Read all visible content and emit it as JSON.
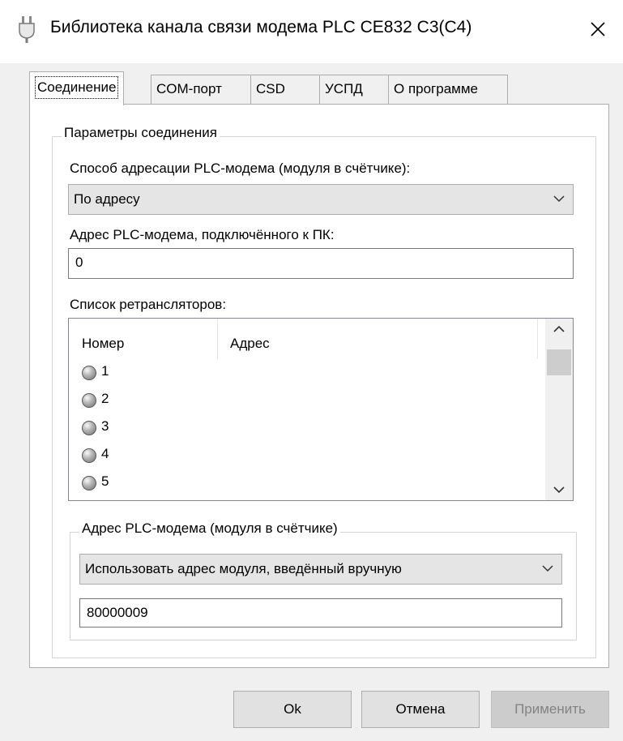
{
  "window": {
    "title": "Библиотека канала связи модема PLC CE832 C3(C4)",
    "icon": "plug-icon",
    "close_icon": "close-icon"
  },
  "tabs": [
    {
      "label": "Соединение",
      "active": true
    },
    {
      "label": "COM-порт",
      "active": false
    },
    {
      "label": "CSD",
      "active": false
    },
    {
      "label": "УСПД",
      "active": false
    },
    {
      "label": "О программе",
      "active": false
    }
  ],
  "connection_params": {
    "group_label": "Параметры соединения",
    "addressing_method_label": "Способ адресации PLC-модема (модуля в счётчике):",
    "addressing_method_value": "По адресу",
    "pc_modem_address_label": "Адрес PLC-модема, подключённого к ПК:",
    "pc_modem_address_value": "0",
    "repeaters_label": "Список ретрансляторов:",
    "repeaters_table": {
      "columns": [
        "Номер",
        "Адрес"
      ],
      "rows": [
        {
          "number": "1",
          "address": ""
        },
        {
          "number": "2",
          "address": ""
        },
        {
          "number": "3",
          "address": ""
        },
        {
          "number": "4",
          "address": ""
        },
        {
          "number": "5",
          "address": ""
        }
      ]
    },
    "module_address_group_label": "Адрес PLC-модема (модуля в счётчике)",
    "module_address_mode_value": "Использовать адрес модуля, введённый вручную",
    "module_address_value": "80000009"
  },
  "buttons": {
    "ok": "Ok",
    "cancel": "Отмена",
    "apply": "Применить"
  }
}
